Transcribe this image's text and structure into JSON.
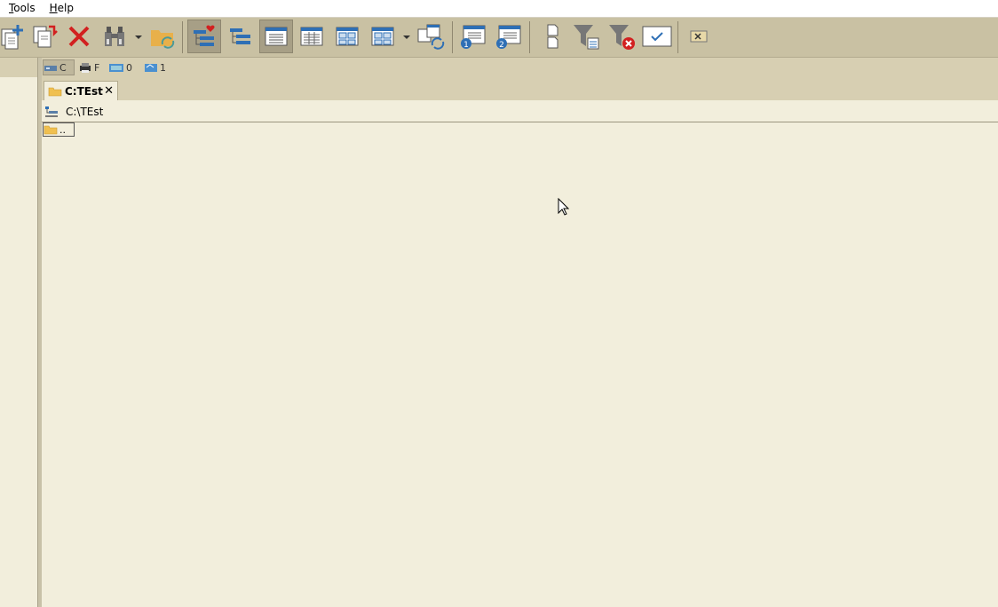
{
  "menu": {
    "tools_first": "T",
    "tools_rest": "ools",
    "help_first": "H",
    "help_rest": "elp"
  },
  "toolbar": {
    "icons": [
      "new-copy-icon",
      "copy-icon",
      "delete-icon",
      "binoculars-icon",
      "folder-sync-icon",
      "favorites-tree-icon",
      "tree-icon",
      "brief-view-icon",
      "detailed-view-icon",
      "thumbnail-view-icon",
      "thumbnail-view-2-icon",
      "refresh-panel-icon",
      "panel-1-icon",
      "panel-2-icon",
      "file-compare-icon",
      "filter-icon",
      "filter-clear-icon",
      "checkbox-icon",
      "extract-icon"
    ]
  },
  "drives": [
    {
      "label": "C",
      "icon": "hard-drive-icon",
      "active": true
    },
    {
      "label": "F",
      "icon": "printer-drive-icon",
      "active": false
    },
    {
      "label": "0",
      "icon": "network-drive-icon",
      "active": false
    },
    {
      "label": "1",
      "icon": "network-drive-2-icon",
      "active": false
    }
  ],
  "tab": {
    "label": "C:TEst",
    "close": "✕"
  },
  "path": {
    "text": "C:\\TEst"
  },
  "files": [
    {
      "name": ".."
    }
  ],
  "colors": {
    "background": "#f2eedc",
    "toolbar": "#c9c1a3",
    "accent_blue": "#2e6fb5",
    "delete_red": "#d22020"
  }
}
